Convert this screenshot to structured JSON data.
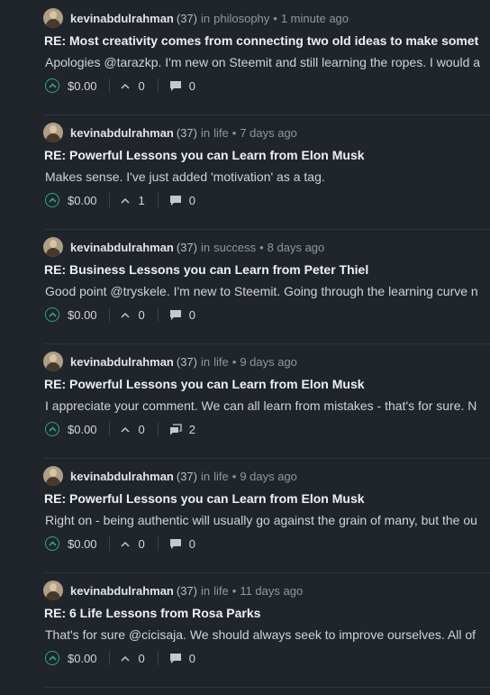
{
  "posts": [
    {
      "author": "kevinabdulrahman",
      "reputation": "(37)",
      "in_word": "in",
      "category": "philosophy",
      "time": "1 minute ago",
      "title": "RE: Most creativity comes from connecting two old ideas to make somet",
      "body": "Apologies @tarazkp. I'm new on Steemit and still learning the ropes. I would a",
      "payout": "$0.00",
      "votes": "0",
      "comments": "0"
    },
    {
      "author": "kevinabdulrahman",
      "reputation": "(37)",
      "in_word": "in",
      "category": "life",
      "time": "7 days ago",
      "title": "RE: Powerful Lessons you can Learn from Elon Musk",
      "body": "Makes sense. I've just added 'motivation' as a tag.",
      "payout": "$0.00",
      "votes": "1",
      "comments": "0"
    },
    {
      "author": "kevinabdulrahman",
      "reputation": "(37)",
      "in_word": "in",
      "category": "success",
      "time": "8 days ago",
      "title": "RE: Business Lessons you can Learn from Peter Thiel",
      "body": "Good point @tryskele. I'm new to Steemit. Going through the learning curve n",
      "payout": "$0.00",
      "votes": "0",
      "comments": "0"
    },
    {
      "author": "kevinabdulrahman",
      "reputation": "(37)",
      "in_word": "in",
      "category": "life",
      "time": "9 days ago",
      "title": "RE: Powerful Lessons you can Learn from Elon Musk",
      "body": "I appreciate your comment. We can all learn from mistakes - that's for sure. N",
      "payout": "$0.00",
      "votes": "0",
      "comments": "2"
    },
    {
      "author": "kevinabdulrahman",
      "reputation": "(37)",
      "in_word": "in",
      "category": "life",
      "time": "9 days ago",
      "title": "RE: Powerful Lessons you can Learn from Elon Musk",
      "body": "Right on - being authentic will usually go against the grain of many, but the ou",
      "payout": "$0.00",
      "votes": "0",
      "comments": "0"
    },
    {
      "author": "kevinabdulrahman",
      "reputation": "(37)",
      "in_word": "in",
      "category": "life",
      "time": "11 days ago",
      "title": "RE: 6 Life Lessons from Rosa Parks",
      "body": "That's for sure @cicisaja. We should always seek to improve ourselves. All of",
      "payout": "$0.00",
      "votes": "0",
      "comments": "0"
    }
  ],
  "separator": "•",
  "colors": {
    "background": "#1f252b",
    "accent": "#2fa58d",
    "divider": "#2e353c"
  },
  "icons": {
    "upvote": "chevron-up-circle-icon",
    "vote_count": "chevron-up-icon",
    "comment": "comment-bubble-icon"
  }
}
